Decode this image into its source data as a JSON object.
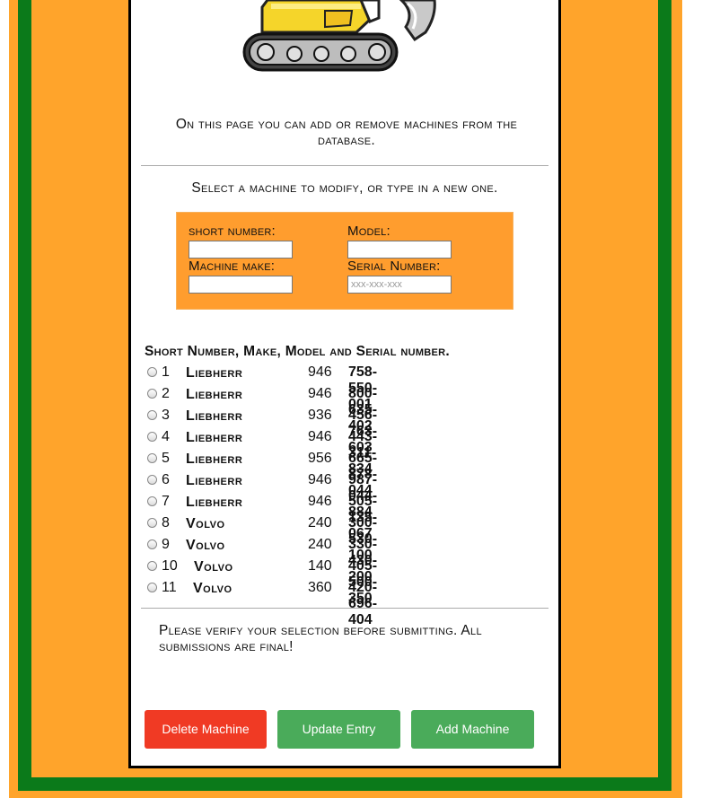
{
  "intro_text": "On this page you can add or remove machines from the database.",
  "select_text": "Select a machine to modify, or type in a new one.",
  "form": {
    "short_number_label": "short number:",
    "model_label": "Model:",
    "make_label": "Machine make:",
    "serial_label": "Serial Number:",
    "short_number_value": "",
    "model_value": "",
    "make_value": "",
    "serial_value": "",
    "serial_placeholder": "xxx-xxx-xxx"
  },
  "list_heading": "Short Number, Make, Model and Serial number.",
  "machines": [
    {
      "num": "1",
      "make": "Liebherr",
      "model": "946",
      "serial": "758-550-001"
    },
    {
      "num": "2",
      "make": "Liebherr",
      "model": "946",
      "serial": "800-635-402"
    },
    {
      "num": "3",
      "make": "Liebherr",
      "model": "936",
      "serial": "456-763-603"
    },
    {
      "num": "4",
      "make": "Liebherr",
      "model": "946",
      "serial": "443-311-834"
    },
    {
      "num": "5",
      "make": "Liebherr",
      "model": "956",
      "serial": "665-878-044"
    },
    {
      "num": "6",
      "make": "Liebherr",
      "model": "946",
      "serial": "987-044-884"
    },
    {
      "num": "7",
      "make": "Liebherr",
      "model": "946",
      "serial": "505-135-067"
    },
    {
      "num": "8",
      "make": "Volvo",
      "model": "240",
      "serial": "300-530-100"
    },
    {
      "num": "9",
      "make": "Volvo",
      "model": "240",
      "serial": "330-430-200"
    },
    {
      "num": "10",
      "make": "Volvo",
      "model": "140",
      "serial": "405-500-350"
    },
    {
      "num": "11",
      "make": "Volvo",
      "model": "360",
      "serial": "420-696-404"
    }
  ],
  "verify_text": "Please verify your selection before submitting. All submissions are final!",
  "buttons": {
    "delete_label": "Delete Machine",
    "update_label": "Update Entry",
    "add_label": "Add Machine"
  },
  "colors": {
    "page_orange": "#ffa42b",
    "frame_green": "#0b7a1a",
    "delete_red": "#f03a24",
    "action_green": "#4aab5a"
  }
}
